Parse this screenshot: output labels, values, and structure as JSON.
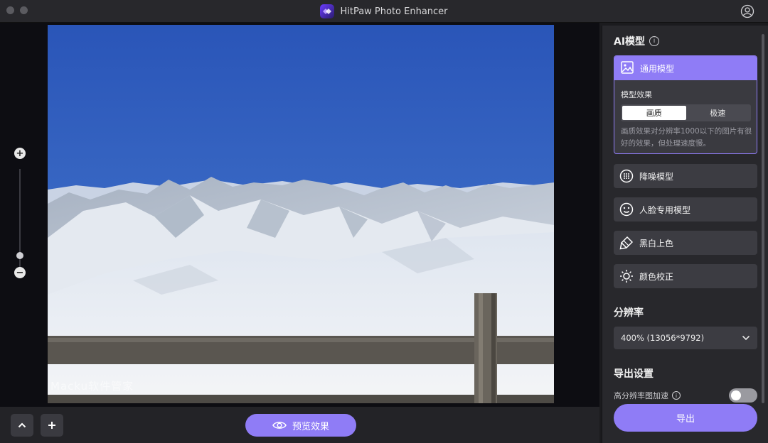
{
  "app": {
    "title": "HitPaw Photo Enhancer"
  },
  "canvas": {
    "watermark": "Macku软件管家"
  },
  "bottombar": {
    "preview_label": "预览效果"
  },
  "panel": {
    "ai_model_title": "AI模型",
    "models": [
      {
        "label": "通用模型",
        "icon": "image-icon",
        "active": true
      },
      {
        "label": "降噪模型",
        "icon": "denoise-icon"
      },
      {
        "label": "人脸专用模型",
        "icon": "face-icon"
      },
      {
        "label": "黑白上色",
        "icon": "colorize-icon"
      },
      {
        "label": "颜色校正",
        "icon": "brightness-icon"
      }
    ],
    "effect_label": "模型效果",
    "effect_options": [
      "画质",
      "极速"
    ],
    "effect_selected": "画质",
    "effect_desc": "画质效果对分辨率1000以下的图片有很好的效果，但处理速度慢。",
    "resolution_title": "分辨率",
    "resolution_value": "400% (13056*9792)",
    "export_settings_title": "导出设置",
    "hw_accel_label": "高分辨率图加速",
    "hw_accel_on": false,
    "export_label": "导出"
  },
  "colors": {
    "accent": "#8f7cf6",
    "panel_bg": "#28282c",
    "canvas_bg": "#0d0d12"
  }
}
